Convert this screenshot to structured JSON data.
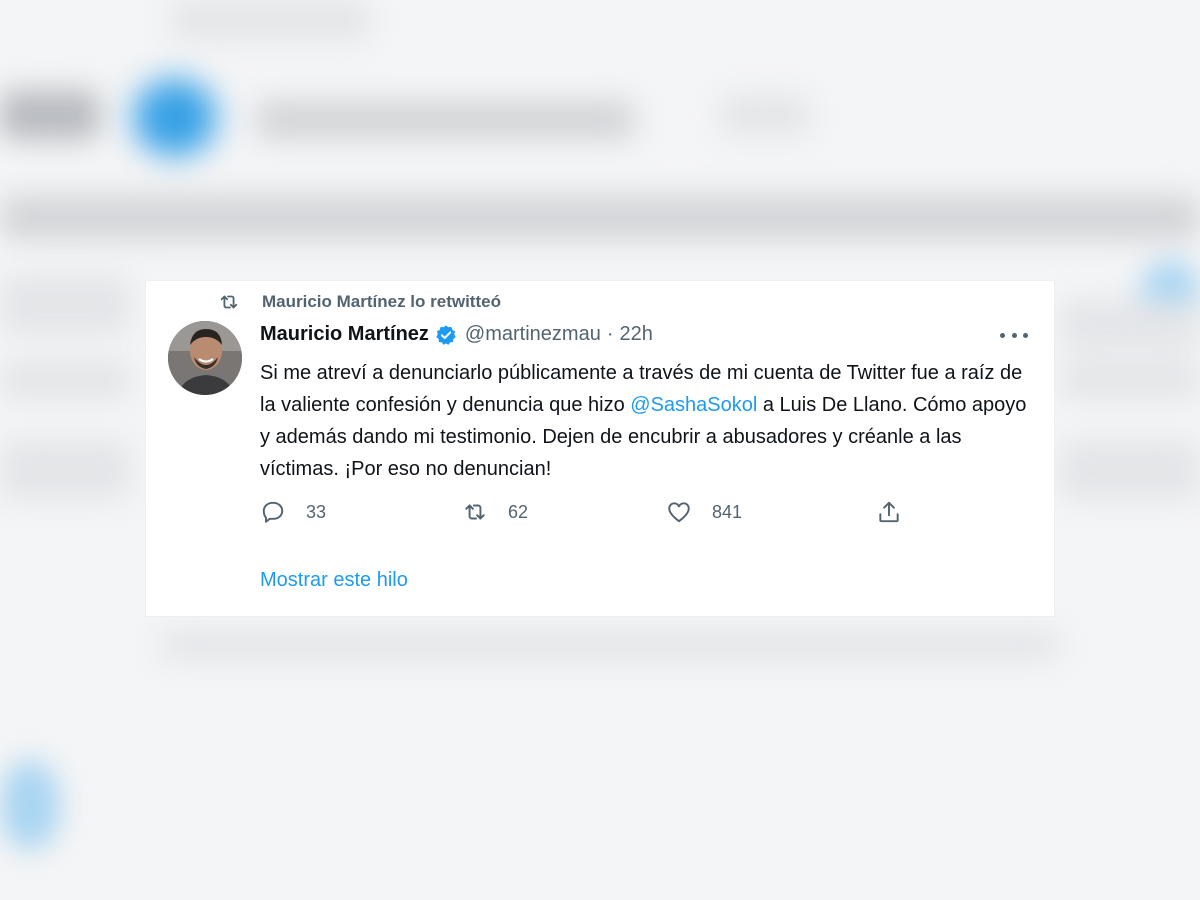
{
  "retweet": {
    "icon": "retweet-icon",
    "text": "Mauricio Martínez lo retwitteó"
  },
  "tweet": {
    "author_name": "Mauricio Martínez",
    "verified": true,
    "handle": "@martinezmau",
    "separator": "·",
    "time": "22h",
    "text_before": "Si me atreví a denunciarlo públicamente a través de mi cuenta de Twitter fue a raíz de la valiente confesión y denuncia que hizo ",
    "mention": "@SashaSokol",
    "text_after": " a Luis De Llano. Cómo apoyo y además dando mi testimonio. Dejen de encubrir a abusadores y créanle a las víctimas. ¡Por eso no denuncian!"
  },
  "actions": {
    "replies": "33",
    "retweets": "62",
    "likes": "841"
  },
  "show_thread": "Mostrar este hilo",
  "colors": {
    "accent": "#1d9bf0",
    "text_primary": "#0f1419",
    "text_secondary": "#536471"
  }
}
